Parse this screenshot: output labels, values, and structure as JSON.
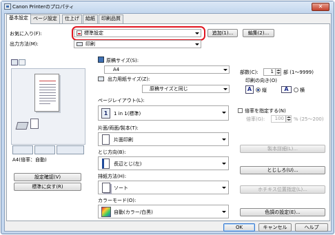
{
  "window": {
    "title": "Canon Printerのプロパティ",
    "close_glyph": "✕"
  },
  "tabs": [
    "基本設定",
    "ページ設定",
    "仕上げ",
    "給紙",
    "印刷品質"
  ],
  "favorites": {
    "label": "お気に入り(F):",
    "value": "標準設定",
    "add_button": "追加(1)...",
    "edit_button": "編集(2)..."
  },
  "output": {
    "label": "出力方法(M):",
    "value": "印刷"
  },
  "preview": {
    "caption": "A4(倍率：自動)",
    "settings_button": "設定確認(V)",
    "restore_button": "標準に戻す(R)"
  },
  "paper": {
    "original_size_label": "原稿サイズ(S):",
    "original_size_value": "A4",
    "output_size_label": "出力用紙サイズ(Z):",
    "output_size_value": "原稿サイズと同じ"
  },
  "copies": {
    "label": "部数(C):",
    "value": "1",
    "range": "部 (1～9999)"
  },
  "orientation": {
    "label": "印刷の向き(O)",
    "portrait": "縦",
    "landscape": "横",
    "portrait_letter": "A",
    "landscape_letter": "A",
    "selected": "portrait"
  },
  "layout": {
    "label": "ページレイアウト(L):",
    "value": "1 in 1(標準)",
    "icon_text": "1"
  },
  "zoom": {
    "label": "倍率を指定する(N)",
    "rate_label": "倍率(G):",
    "rate_value": "100",
    "rate_range": "% (25～200)",
    "checked": false
  },
  "print_style": {
    "label": "片面/両面/製本(T):",
    "value": "片面印刷",
    "detail_button": "製本詳細(L)..."
  },
  "binding": {
    "label": "とじ方向(B):",
    "value": "長辺とじ(左)",
    "button": "とじしろ(U)..."
  },
  "output_method": {
    "label": "排紙方法(H):",
    "value": "ソート",
    "staple_button": "ホチキス位置指定(L)..."
  },
  "color": {
    "label": "カラーモード(O):",
    "value": "自動(カラー/白黒)",
    "button": "色調の設定(E)..."
  },
  "footer": {
    "ok": "OK",
    "cancel": "キャンセル",
    "help": "ヘルプ"
  },
  "colors": {
    "highlight": "#e0141e",
    "title_bar": "#c4d7ee"
  }
}
